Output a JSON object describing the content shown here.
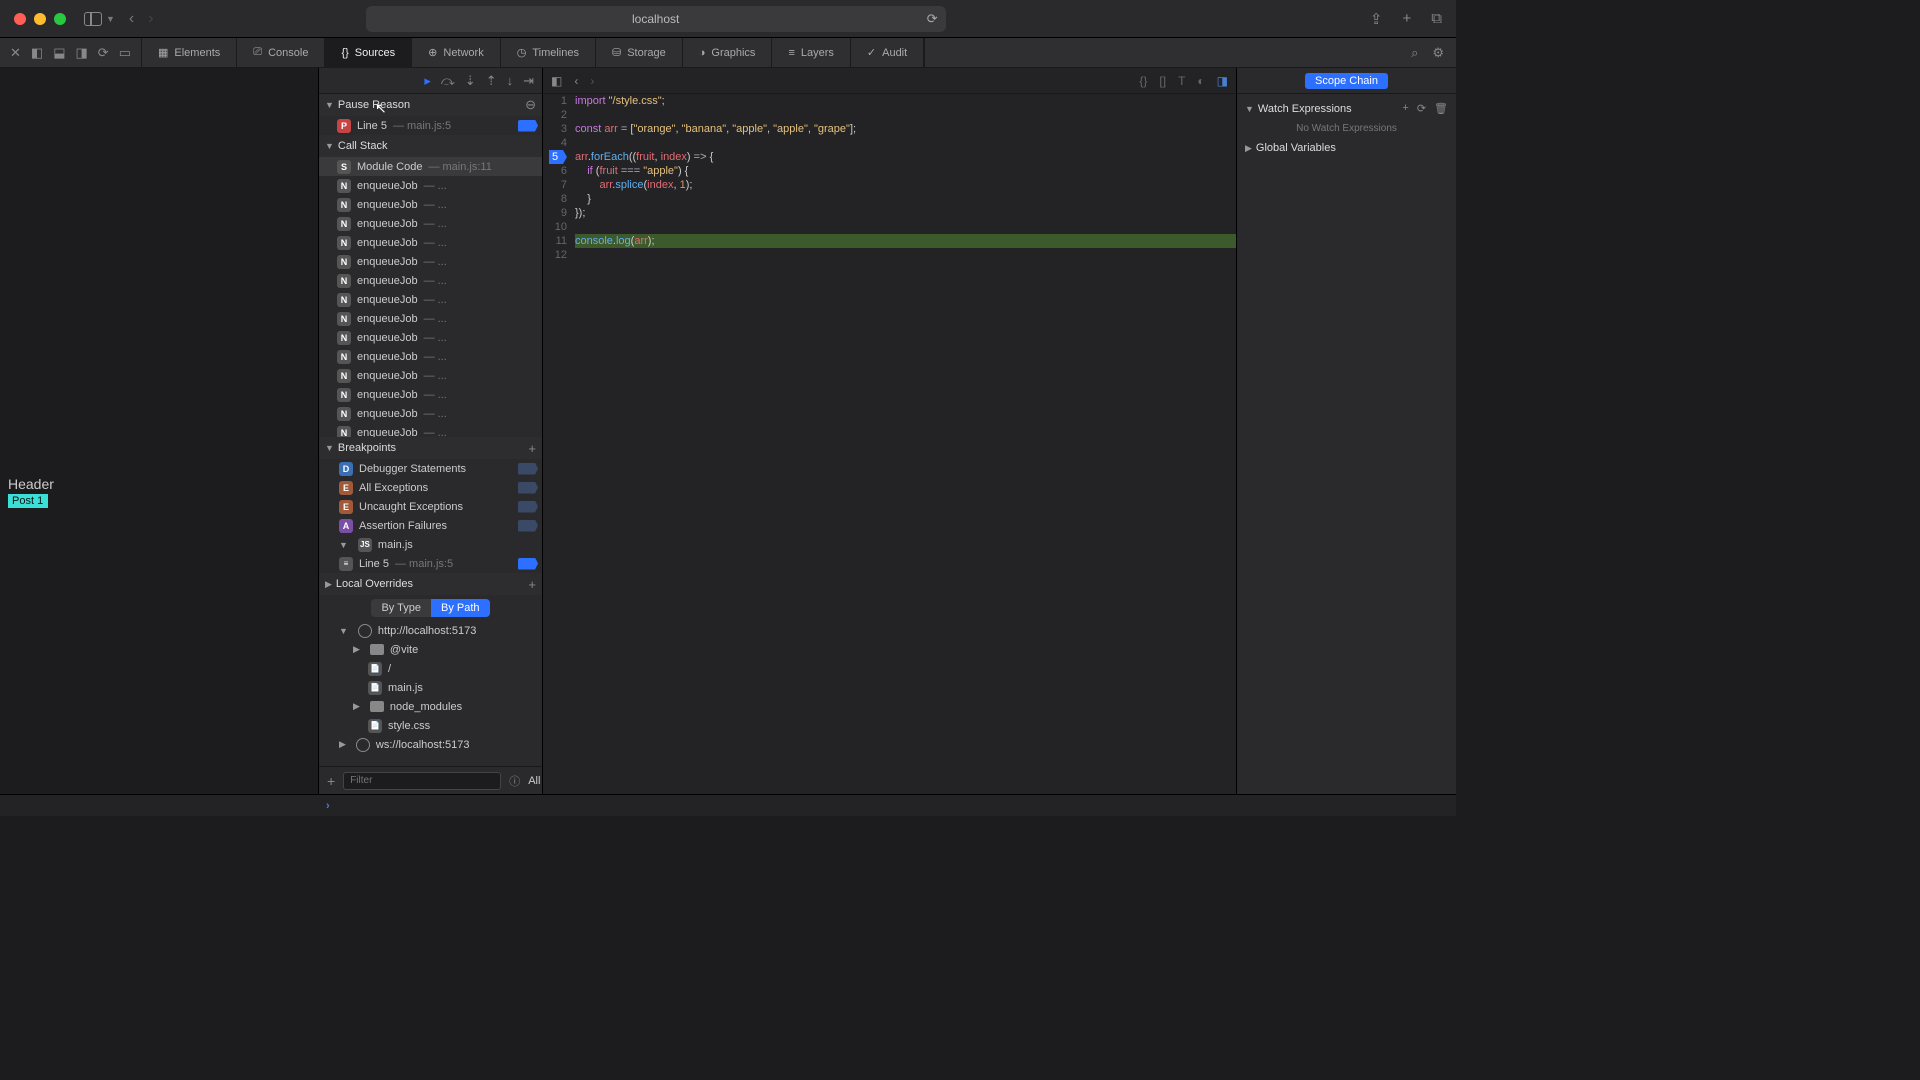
{
  "titlebar": {
    "url": "localhost"
  },
  "page": {
    "header": "Header",
    "post": "Post 1"
  },
  "devtabs": [
    "Elements",
    "Console",
    "Sources",
    "Network",
    "Timelines",
    "Storage",
    "Graphics",
    "Layers",
    "Audit"
  ],
  "activeTab": "Sources",
  "pauseReason": {
    "title": "Pause Reason",
    "badge": "P",
    "label": "Line 5",
    "file": "main.js:5"
  },
  "callStack": {
    "title": "Call Stack",
    "frames": [
      {
        "badge": "S",
        "label": "Module Code",
        "file": "main.js:11",
        "selected": true
      },
      {
        "badge": "N",
        "label": "enqueueJob",
        "file": "..."
      },
      {
        "badge": "N",
        "label": "enqueueJob",
        "file": "..."
      },
      {
        "badge": "N",
        "label": "enqueueJob",
        "file": "..."
      },
      {
        "badge": "N",
        "label": "enqueueJob",
        "file": "..."
      },
      {
        "badge": "N",
        "label": "enqueueJob",
        "file": "..."
      },
      {
        "badge": "N",
        "label": "enqueueJob",
        "file": "..."
      },
      {
        "badge": "N",
        "label": "enqueueJob",
        "file": "..."
      },
      {
        "badge": "N",
        "label": "enqueueJob",
        "file": "..."
      },
      {
        "badge": "N",
        "label": "enqueueJob",
        "file": "..."
      },
      {
        "badge": "N",
        "label": "enqueueJob",
        "file": "..."
      },
      {
        "badge": "N",
        "label": "enqueueJob",
        "file": "..."
      },
      {
        "badge": "N",
        "label": "enqueueJob",
        "file": "..."
      },
      {
        "badge": "N",
        "label": "enqueueJob",
        "file": "..."
      },
      {
        "badge": "N",
        "label": "enqueueJob",
        "file": "..."
      }
    ]
  },
  "breakpoints": {
    "title": "Breakpoints",
    "items": [
      {
        "badge": "D",
        "label": "Debugger Statements",
        "enabled": false
      },
      {
        "badge": "E",
        "label": "All Exceptions",
        "enabled": false
      },
      {
        "badge": "E",
        "label": "Uncaught Exceptions",
        "enabled": false
      },
      {
        "badge": "A",
        "label": "Assertion Failures",
        "enabled": false
      }
    ],
    "file": "main.js",
    "fileItems": [
      {
        "label": "Line 5",
        "file": "main.js:5",
        "enabled": true
      }
    ]
  },
  "localOverrides": {
    "title": "Local Overrides"
  },
  "grouping": {
    "options": [
      "By Type",
      "By Path"
    ],
    "active": "By Path"
  },
  "sources": {
    "roots": [
      {
        "url": "http://localhost:5173",
        "children": [
          {
            "type": "folder",
            "name": "@vite"
          },
          {
            "type": "file",
            "name": "/"
          },
          {
            "type": "file",
            "name": "main.js"
          },
          {
            "type": "folder",
            "name": "node_modules"
          },
          {
            "type": "file",
            "name": "style.css"
          }
        ]
      },
      {
        "url": "ws://localhost:5173"
      }
    ]
  },
  "filter": {
    "placeholder": "Filter",
    "scope": "All"
  },
  "code": {
    "lines": [
      {
        "n": 1,
        "html": "<span class='kw'>import</span> <span class='str'>\"/style.css\"</span>;"
      },
      {
        "n": 2,
        "html": ""
      },
      {
        "n": 3,
        "html": "<span class='kw'>const</span> <span class='var'>arr</span> <span class='op'>=</span> [<span class='str'>\"orange\"</span>, <span class='str'>\"banana\"</span>, <span class='str'>\"apple\"</span>, <span class='str'>\"apple\"</span>, <span class='str'>\"grape\"</span>];"
      },
      {
        "n": 4,
        "html": ""
      },
      {
        "n": 5,
        "html": "<span class='var'>arr</span>.<span class='fn'>forEach</span>((<span class='var'>fruit</span>, <span class='var'>index</span>) <span class='op'>=&gt;</span> {",
        "exec": true
      },
      {
        "n": 6,
        "html": "    <span class='kw'>if</span> (<span class='var'>fruit</span> <span class='op'>===</span> <span class='str'>\"apple\"</span>) {"
      },
      {
        "n": 7,
        "html": "        <span class='var'>arr</span>.<span class='fn'>splice</span>(<span class='var'>index</span>, <span class='num'>1</span>);"
      },
      {
        "n": 8,
        "html": "    }"
      },
      {
        "n": 9,
        "html": "});"
      },
      {
        "n": 10,
        "html": ""
      },
      {
        "n": 11,
        "html": "<span class='fn'>console</span>.<span class='fn'>log</span>(<span class='var'>arr</span>);",
        "hl": true
      },
      {
        "n": 12,
        "html": ""
      }
    ]
  },
  "rightPanel": {
    "scopeTab": "Scope Chain",
    "watch": {
      "title": "Watch Expressions",
      "empty": "No Watch Expressions"
    },
    "globals": {
      "title": "Global Variables"
    }
  }
}
